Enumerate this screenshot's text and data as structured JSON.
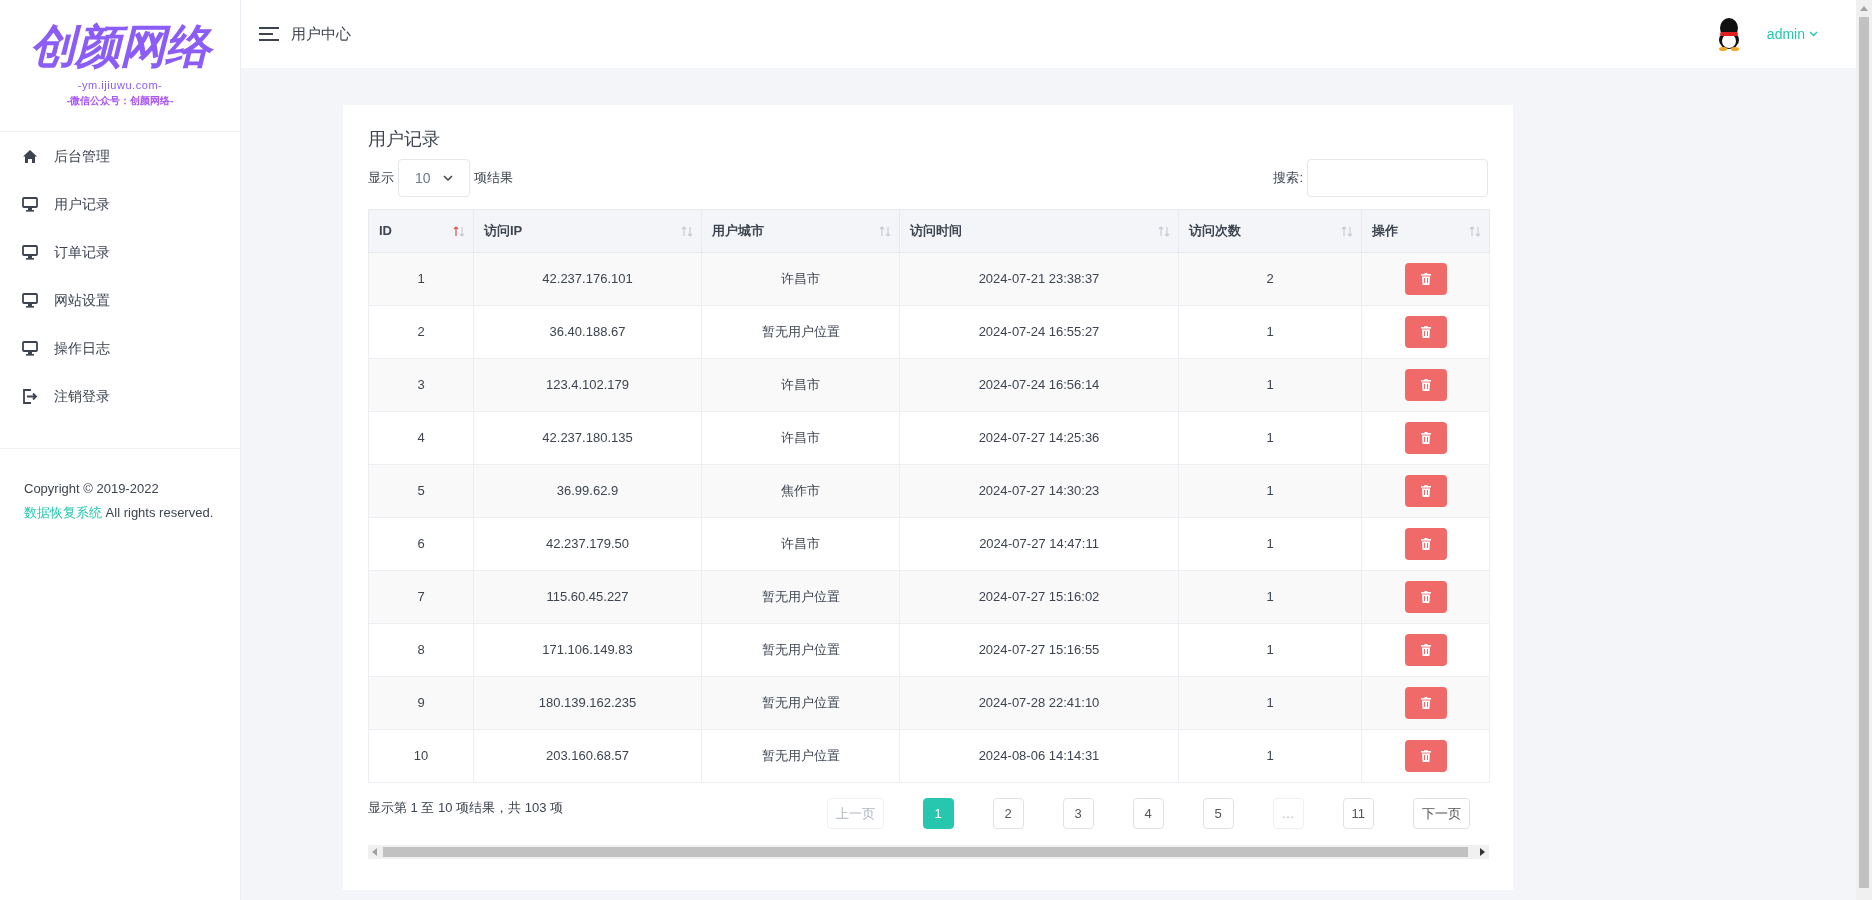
{
  "sidebar": {
    "logo": {
      "title": "创颜网络",
      "url": "-ym.ijiuwu.com-",
      "subtitle": "-微信公众号：创颜网络-"
    },
    "items": [
      {
        "label": "后台管理",
        "selected": false
      },
      {
        "label": "用户记录",
        "selected": false
      },
      {
        "label": "订单记录",
        "selected": false
      },
      {
        "label": "网站设置",
        "selected": false
      },
      {
        "label": "操作日志",
        "selected": false
      },
      {
        "label": "注销登录",
        "selected": false
      }
    ],
    "footer": {
      "prefix": "Copyright © 2019-2022 ",
      "link": "数据恢复系统",
      "suffix": " All rights reserved."
    }
  },
  "header": {
    "title": "用户中心",
    "user": "admin"
  },
  "card": {
    "title": "用户记录",
    "length": {
      "before": "显示",
      "value": "10",
      "after": "项结果"
    },
    "search": {
      "label": "搜索:"
    },
    "table": {
      "columns": [
        {
          "label": "ID",
          "sorted": true
        },
        {
          "label": "访问IP",
          "sorted": false
        },
        {
          "label": "用户城市",
          "sorted": false
        },
        {
          "label": "访问时间",
          "sorted": false
        },
        {
          "label": "访问次数",
          "sorted": false
        },
        {
          "label": "操作",
          "sorted": false
        }
      ],
      "rows": [
        [
          "1",
          "42.237.176.101",
          "许昌市",
          "2024-07-21 23:38:37",
          "2"
        ],
        [
          "2",
          "36.40.188.67",
          "暂无用户位置",
          "2024-07-24 16:55:27",
          "1"
        ],
        [
          "3",
          "123.4.102.179",
          "许昌市",
          "2024-07-24 16:56:14",
          "1"
        ],
        [
          "4",
          "42.237.180.135",
          "许昌市",
          "2024-07-27 14:25:36",
          "1"
        ],
        [
          "5",
          "36.99.62.9",
          "焦作市",
          "2024-07-27 14:30:23",
          "1"
        ],
        [
          "6",
          "42.237.179.50",
          "许昌市",
          "2024-07-27 14:47:11",
          "1"
        ],
        [
          "7",
          "115.60.45.227",
          "暂无用户位置",
          "2024-07-27 15:16:02",
          "1"
        ],
        [
          "8",
          "171.106.149.83",
          "暂无用户位置",
          "2024-07-27 15:16:55",
          "1"
        ],
        [
          "9",
          "180.139.162.235",
          "暂无用户位置",
          "2024-07-28 22:41:10",
          "1"
        ],
        [
          "10",
          "203.160.68.57",
          "暂无用户位置",
          "2024-08-06 14:14:31",
          "1"
        ]
      ]
    },
    "info": "显示第 1 至 10 项结果，共 103 项",
    "pagination": [
      {
        "label": "上一页",
        "selected": false,
        "disabled": true
      },
      {
        "label": "1",
        "selected": true,
        "disabled": false
      },
      {
        "label": "2",
        "selected": false,
        "disabled": false
      },
      {
        "label": "3",
        "selected": false,
        "disabled": false
      },
      {
        "label": "4",
        "selected": false,
        "disabled": false
      },
      {
        "label": "5",
        "selected": false,
        "disabled": false
      },
      {
        "label": "…",
        "selected": false,
        "disabled": true
      },
      {
        "label": "11",
        "selected": false,
        "disabled": false
      },
      {
        "label": "下一页",
        "selected": false,
        "disabled": false
      }
    ]
  }
}
